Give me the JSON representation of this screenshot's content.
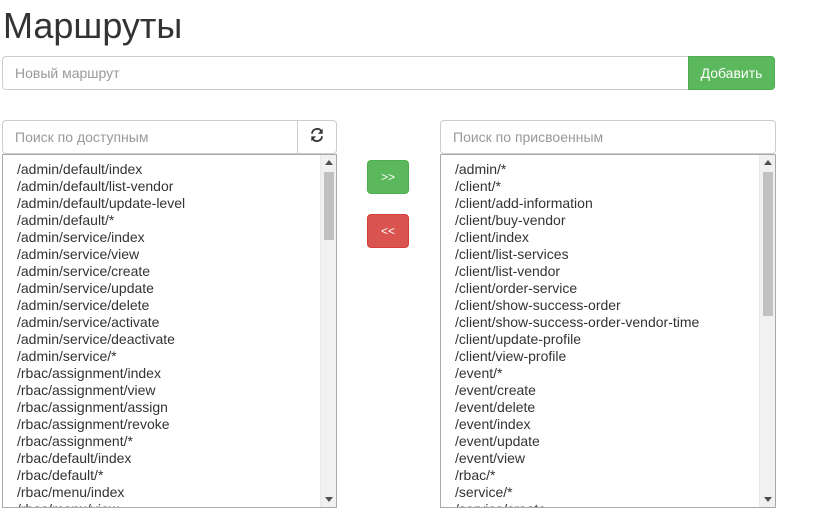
{
  "page": {
    "title": "Маршруты"
  },
  "new_route": {
    "placeholder": "Новый маршрут",
    "add_label": "Добавить"
  },
  "available": {
    "search_placeholder": "Поиск по доступным",
    "items": [
      "/admin/default/index",
      "/admin/default/list-vendor",
      "/admin/default/update-level",
      "/admin/default/*",
      "/admin/service/index",
      "/admin/service/view",
      "/admin/service/create",
      "/admin/service/update",
      "/admin/service/delete",
      "/admin/service/activate",
      "/admin/service/deactivate",
      "/admin/service/*",
      "/rbac/assignment/index",
      "/rbac/assignment/view",
      "/rbac/assignment/assign",
      "/rbac/assignment/revoke",
      "/rbac/assignment/*",
      "/rbac/default/index",
      "/rbac/default/*",
      "/rbac/menu/index",
      "/rbac/menu/view"
    ]
  },
  "assigned": {
    "search_placeholder": "Поиск по присвоенным",
    "items": [
      "/admin/*",
      "/client/*",
      "/client/add-information",
      "/client/buy-vendor",
      "/client/index",
      "/client/list-services",
      "/client/list-vendor",
      "/client/order-service",
      "/client/show-success-order",
      "/client/show-success-order-vendor-time",
      "/client/update-profile",
      "/client/view-profile",
      "/event/*",
      "/event/create",
      "/event/delete",
      "/event/index",
      "/event/update",
      "/event/view",
      "/rbac/*",
      "/service/*",
      "/service/create"
    ]
  },
  "actions": {
    "assign_label": ">>",
    "remove_label": "<<"
  },
  "colors": {
    "success": "#5cb85c",
    "danger": "#d9534f",
    "border": "#cccccc"
  },
  "icons": {
    "refresh": "refresh-icon"
  }
}
